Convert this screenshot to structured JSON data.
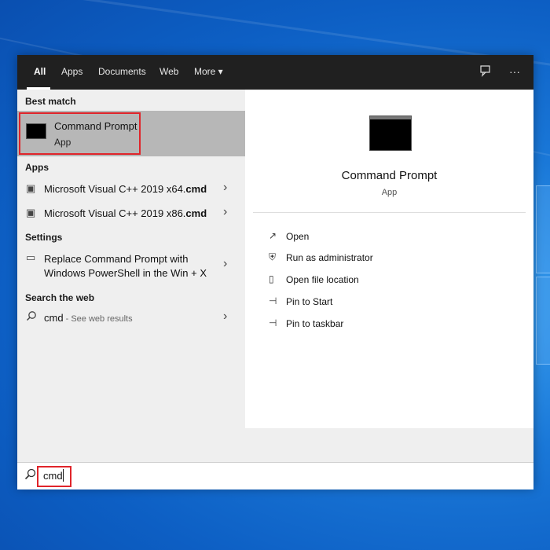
{
  "tabs": [
    {
      "label": "All"
    },
    {
      "label": "Apps"
    },
    {
      "label": "Documents"
    },
    {
      "label": "Web"
    },
    {
      "label": "More ▾"
    }
  ],
  "top_icons": {
    "feedback": "feedback-icon",
    "more": "···"
  },
  "left": {
    "best_match": {
      "section": "Best match",
      "title": "Command Prompt",
      "subtitle": "App"
    },
    "apps": {
      "section": "Apps",
      "items": [
        {
          "prefix": "Microsoft Visual C++ 2019 x64.",
          "bold": "cmd"
        },
        {
          "prefix": "Microsoft Visual C++ 2019 x86.",
          "bold": "cmd"
        }
      ]
    },
    "settings": {
      "section": "Settings",
      "item_line1": "Replace Command Prompt with",
      "item_line2": "Windows PowerShell in the Win + X"
    },
    "web": {
      "section": "Search the web",
      "query": "cmd",
      "suffix": " - See web results"
    }
  },
  "right": {
    "title": "Command Prompt",
    "subtitle": "App",
    "actions": [
      {
        "label": "Open",
        "icon": "open-icon"
      },
      {
        "label": "Run as administrator",
        "icon": "shield-icon"
      },
      {
        "label": "Open file location",
        "icon": "file-icon"
      },
      {
        "label": "Pin to Start",
        "icon": "pin-icon"
      },
      {
        "label": "Pin to taskbar",
        "icon": "pin-icon"
      }
    ]
  },
  "search": {
    "value": "cmd"
  },
  "colors": {
    "highlight": "#e0242a",
    "topbar": "#202020",
    "selected": "#b7b7b7"
  }
}
